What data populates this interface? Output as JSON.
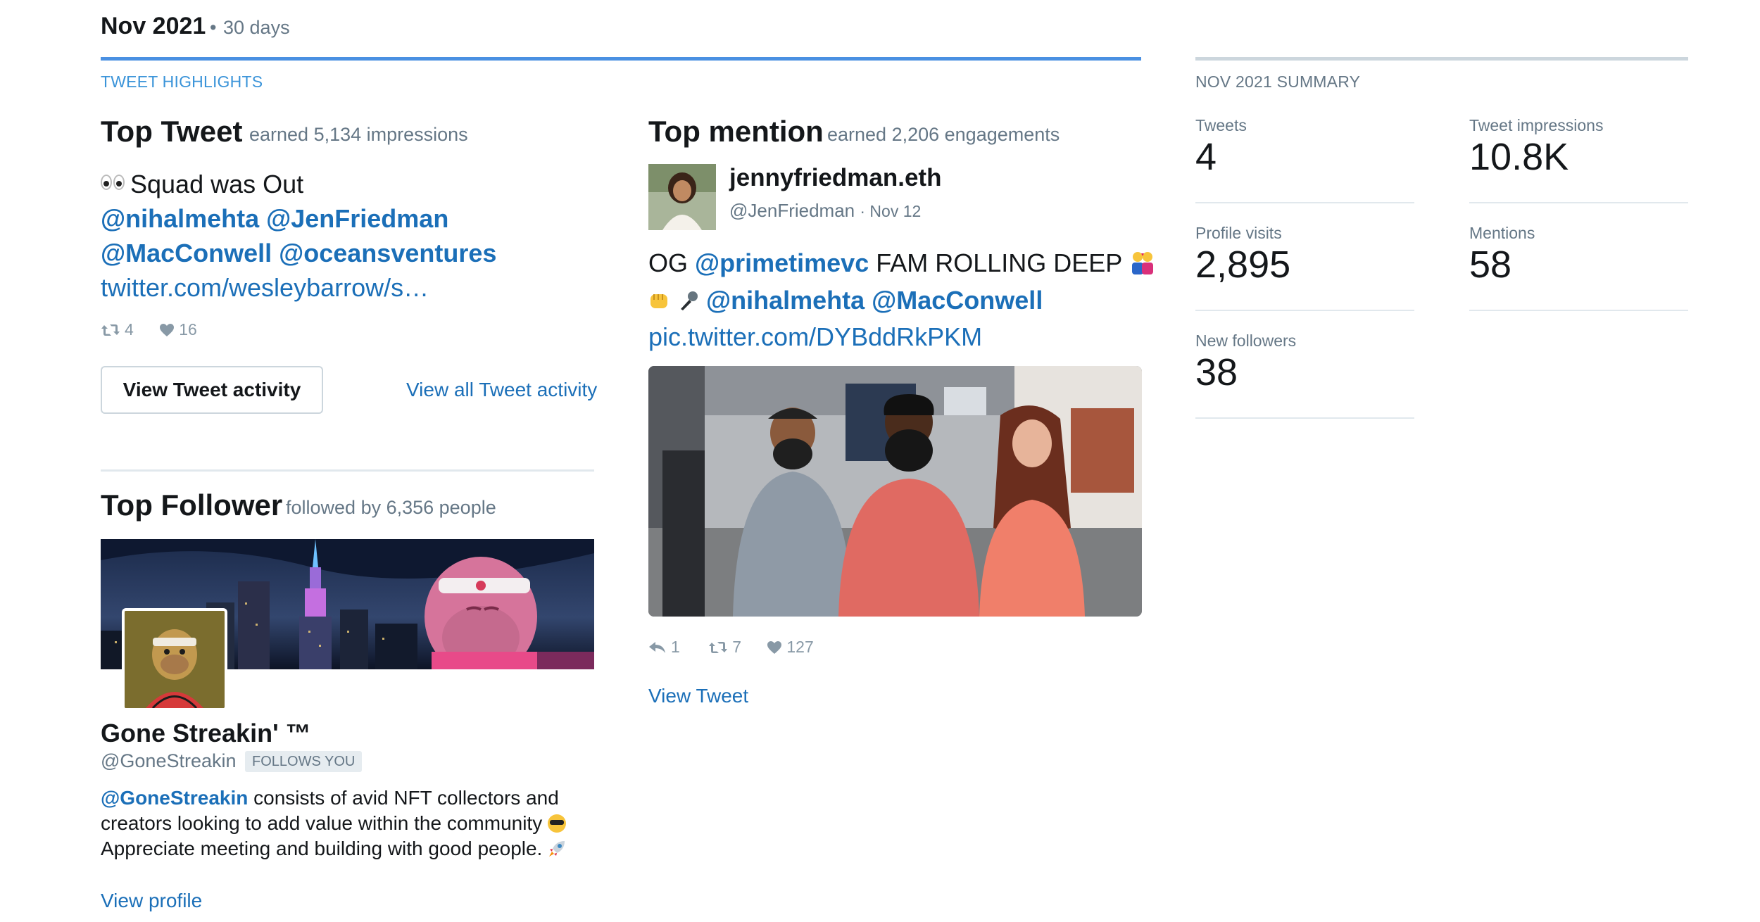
{
  "header": {
    "month": "Nov 2021",
    "dot": "•",
    "range": "30 days"
  },
  "highlights": {
    "label": "TWEET HIGHLIGHTS",
    "top_tweet": {
      "title": "Top Tweet",
      "subtitle": "earned 5,134 impressions",
      "text_lead": "Squad was Out",
      "mentions_line1": "@nihalmehta @JenFriedman",
      "mentions_line2": "@MacConwell @oceansventures",
      "link": "twitter.com/wesleybarrow/s…",
      "retweets": "4",
      "likes": "16",
      "button": "View Tweet activity",
      "all_link": "View all Tweet activity"
    },
    "top_follower": {
      "title": "Top Follower",
      "subtitle": "followed by 6,356 people",
      "name": "Gone Streakin' ™",
      "handle": "@GoneStreakin",
      "badge": "FOLLOWS YOU",
      "bio_mention": "@GoneStreakin",
      "bio_line1_rest": " consists of avid NFT collectors and",
      "bio_line2": "creators looking to add value within the community",
      "bio_line3": "Appreciate meeting and building with good people.",
      "profile_link": "View profile"
    },
    "top_mention": {
      "title": "Top mention",
      "subtitle": "earned 2,206 engagements",
      "name": "jennyfriedman.eth",
      "handle": "@JenFriedman",
      "date": "· Nov 12",
      "text_og": "OG ",
      "text_mention1": "@primetimevc",
      "text_rest": " FAM ROLLING DEEP",
      "text_mentions2": "@nihalmehta @MacConwell",
      "pic_link": "pic.twitter.com/DYBddRkPKM",
      "replies": "1",
      "retweets": "7",
      "likes": "127",
      "view_link": "View Tweet"
    }
  },
  "summary": {
    "label": "NOV 2021 SUMMARY",
    "metrics": [
      {
        "label": "Tweets",
        "value": "4"
      },
      {
        "label": "Tweet impressions",
        "value": "10.8K"
      },
      {
        "label": "Profile visits",
        "value": "2,895"
      },
      {
        "label": "Mentions",
        "value": "58"
      },
      {
        "label": "New followers",
        "value": "38"
      }
    ]
  },
  "colors": {
    "link": "#1b6fb8",
    "accent_bar": "#4a90e2",
    "muted": "#657786"
  },
  "icons": [
    "eyes-emoji",
    "retweet-icon",
    "heart-icon",
    "reply-icon",
    "couple-emoji",
    "fist-emoji",
    "microphone-emoji",
    "sunglasses-emoji",
    "rocket-emoji"
  ]
}
